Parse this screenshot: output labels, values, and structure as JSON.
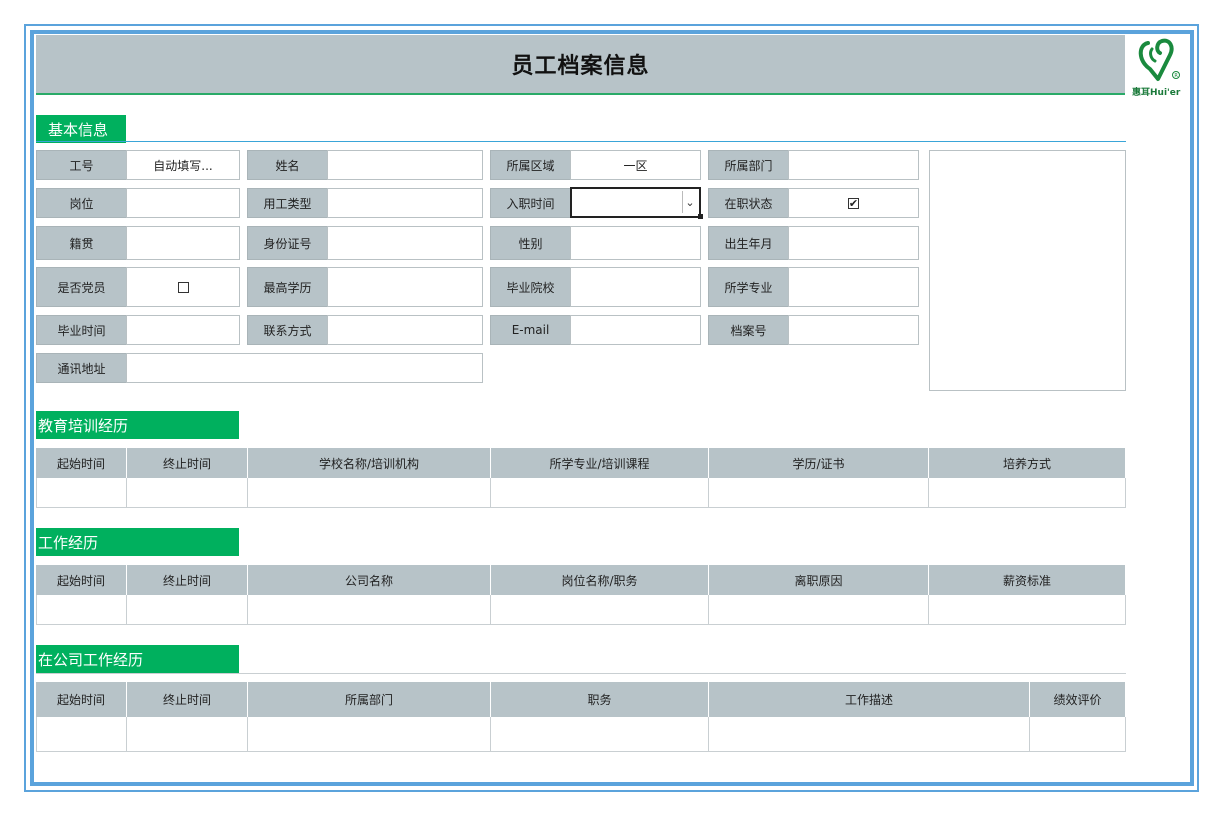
{
  "title": "员工档案信息",
  "logo": {
    "icon": "vh-logo-icon",
    "text": "惠耳Hui'er"
  },
  "colors": {
    "accent": "#00b05e",
    "label_bg": "#b7c3c8",
    "frame": "#5ba3dc"
  },
  "basic": {
    "heading": "基本信息",
    "fields": {
      "employee_id": {
        "label": "工号",
        "value": "自动填写..."
      },
      "name": {
        "label": "姓名",
        "value": ""
      },
      "region": {
        "label": "所属区域",
        "value": "一区"
      },
      "department": {
        "label": "所属部门",
        "value": ""
      },
      "position": {
        "label": "岗位",
        "value": ""
      },
      "employment_type": {
        "label": "用工类型",
        "value": ""
      },
      "hire_date": {
        "label": "入职时间",
        "value": ""
      },
      "active_status": {
        "label": "在职状态",
        "checked": true,
        "mark": "✔"
      },
      "native_place": {
        "label": "籍贯",
        "value": ""
      },
      "id_number": {
        "label": "身份证号",
        "value": ""
      },
      "gender": {
        "label": "性别",
        "value": ""
      },
      "birth_date": {
        "label": "出生年月",
        "value": ""
      },
      "party_member": {
        "label": "是否党员",
        "checked": false,
        "mark": ""
      },
      "education": {
        "label": "最高学历",
        "value": ""
      },
      "school": {
        "label": "毕业院校",
        "value": ""
      },
      "major": {
        "label": "所学专业",
        "value": ""
      },
      "graduation_date": {
        "label": "毕业时间",
        "value": ""
      },
      "contact": {
        "label": "联系方式",
        "value": ""
      },
      "email": {
        "label": "E-mail",
        "value": ""
      },
      "file_number": {
        "label": "档案号",
        "value": ""
      },
      "address": {
        "label": "通讯地址",
        "value": ""
      }
    },
    "dropdown_arrow": "⌄"
  },
  "education_history": {
    "heading": "教育培训经历",
    "columns": [
      "起始时间",
      "终止时间",
      "学校名称/培训机构",
      "所学专业/培训课程",
      "学历/证书",
      "培养方式"
    ]
  },
  "work_history": {
    "heading": "工作经历",
    "columns": [
      "起始时间",
      "终止时间",
      "公司名称",
      "岗位名称/职务",
      "离职原因",
      "薪资标准"
    ]
  },
  "company_history": {
    "heading": "在公司工作经历",
    "columns": [
      "起始时间",
      "终止时间",
      "所属部门",
      "职务",
      "工作描述",
      "绩效评价"
    ]
  }
}
